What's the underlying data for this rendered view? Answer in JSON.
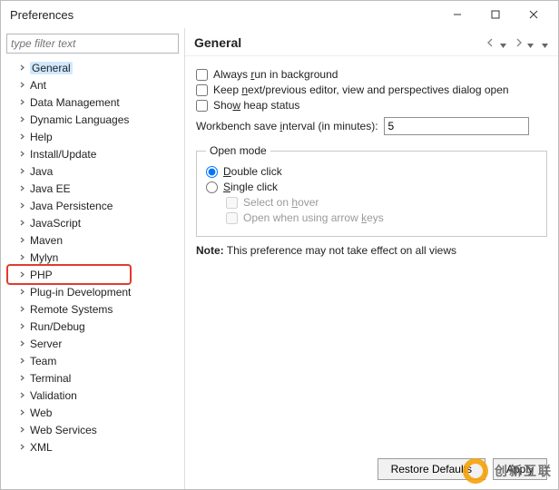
{
  "window": {
    "title": "Preferences"
  },
  "filter": {
    "placeholder": "type filter text"
  },
  "tree": {
    "items": [
      {
        "label": "General",
        "selected": true,
        "highlight": false
      },
      {
        "label": "Ant"
      },
      {
        "label": "Data Management"
      },
      {
        "label": "Dynamic Languages"
      },
      {
        "label": "Help"
      },
      {
        "label": "Install/Update"
      },
      {
        "label": "Java"
      },
      {
        "label": "Java EE"
      },
      {
        "label": "Java Persistence"
      },
      {
        "label": "JavaScript"
      },
      {
        "label": "Maven"
      },
      {
        "label": "Mylyn"
      },
      {
        "label": "PHP",
        "highlight": true
      },
      {
        "label": "Plug-in Development"
      },
      {
        "label": "Remote Systems"
      },
      {
        "label": "Run/Debug"
      },
      {
        "label": "Server"
      },
      {
        "label": "Team"
      },
      {
        "label": "Terminal"
      },
      {
        "label": "Validation"
      },
      {
        "label": "Web"
      },
      {
        "label": "Web Services"
      },
      {
        "label": "XML"
      }
    ]
  },
  "page": {
    "title": "General",
    "checkboxes": {
      "always_run_bg": {
        "label_pre": "Always ",
        "u": "r",
        "label_post": "un in background",
        "checked": false
      },
      "keep_editor": {
        "label_pre": "Keep ",
        "u": "n",
        "label_post": "ext/previous editor, view and perspectives dialog open",
        "checked": false
      },
      "heap": {
        "label_pre": "Sho",
        "u": "w",
        "label_post": " heap status",
        "checked": false
      }
    },
    "interval": {
      "label_pre": "Workbench save ",
      "u": "i",
      "label_post": "nterval (in minutes):",
      "value": "5"
    },
    "open_mode": {
      "legend": "Open mode",
      "double": {
        "u": "D",
        "label": "ouble click",
        "checked": true
      },
      "single": {
        "u": "S",
        "label": "ingle click",
        "checked": false
      },
      "hover": {
        "pre": "Select on ",
        "u": "h",
        "post": "over",
        "checked": false,
        "disabled": true
      },
      "arrow": {
        "pre": "Open when using arrow ",
        "u": "k",
        "post": "eys",
        "checked": false,
        "disabled": true
      }
    },
    "note": {
      "bold": "Note:",
      "text": " This preference may not take effect on all views"
    },
    "buttons": {
      "restore": "Restore Defaults",
      "apply": "Apply"
    }
  },
  "watermark": "创新互联"
}
